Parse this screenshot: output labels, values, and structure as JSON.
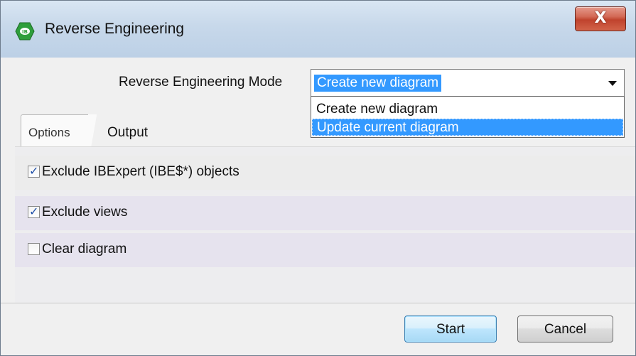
{
  "window": {
    "title": "Reverse Engineering",
    "close_glyph": "X",
    "app_icon": "ibexpert-app-icon",
    "accent_color": "#3399ff"
  },
  "mode": {
    "label": "Reverse Engineering Mode",
    "selected_value": "Create new diagram",
    "options": [
      "Create new diagram",
      "Update current diagram"
    ],
    "highlighted_option": "Update current diagram"
  },
  "tabs": [
    {
      "label": "Options",
      "active": true
    },
    {
      "label": "Output",
      "active": false
    }
  ],
  "options": [
    {
      "label": "Exclude IBExpert (IBE$*) objects",
      "checked": true
    },
    {
      "label": "Exclude views",
      "checked": true
    },
    {
      "label": "Clear diagram",
      "checked": false
    }
  ],
  "buttons": {
    "start": "Start",
    "cancel": "Cancel"
  }
}
